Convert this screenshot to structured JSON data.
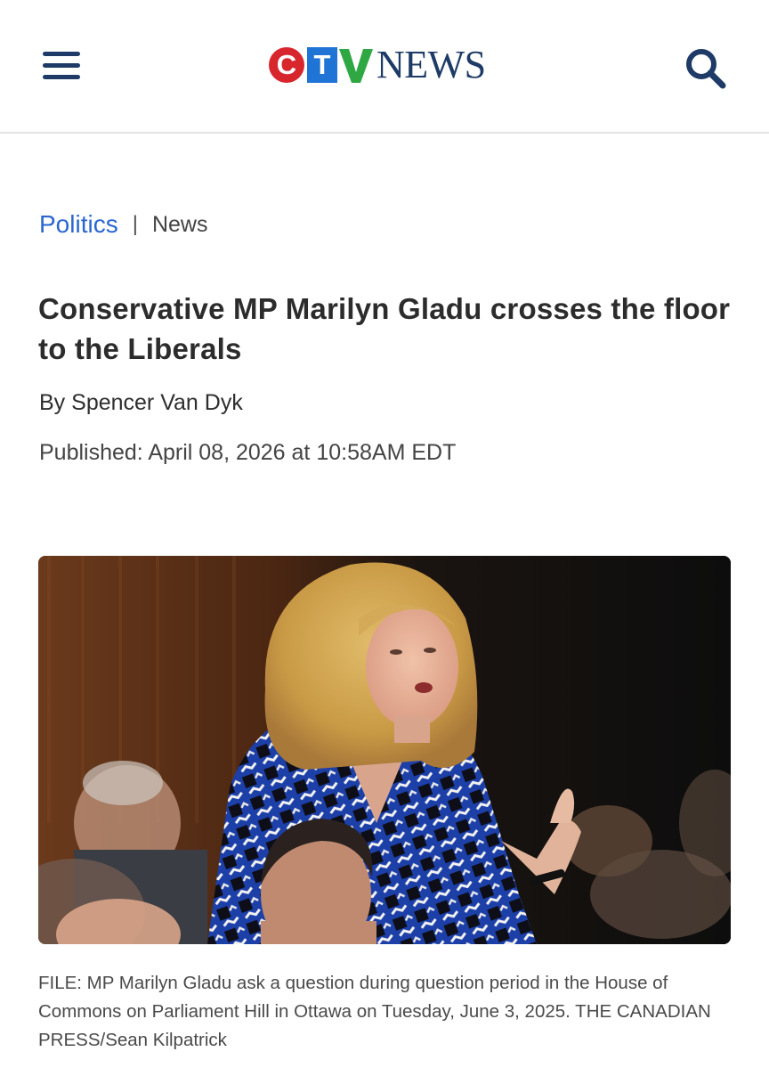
{
  "header": {
    "menu_icon": "hamburger-menu-icon",
    "logo": {
      "letters": [
        "C",
        "T",
        "V"
      ],
      "wordmark": "NEWS",
      "colors": {
        "c": "#d8262d",
        "t": "#1f74d6",
        "v": "#2fa843",
        "news": "#1d3b66"
      }
    },
    "search_icon": "search-icon"
  },
  "article": {
    "section": "Politics",
    "separator": "|",
    "subsection": "News",
    "headline": "Conservative MP Marilyn Gladu crosses the floor to the Liberals",
    "byline_prefix": "By",
    "author": "Spencer Van Dyk",
    "published": "Published: April 08, 2026 at 10:58AM EDT",
    "photo_caption": "FILE: MP Marilyn Gladu ask a question during question period in the House of Commons on Parliament Hill in Ottawa on Tuesday, June 3, 2025. THE CANADIAN PRESS/Sean Kilpatrick"
  },
  "colors": {
    "section_link": "#2a66d0",
    "brand_navy": "#1d3b66"
  }
}
